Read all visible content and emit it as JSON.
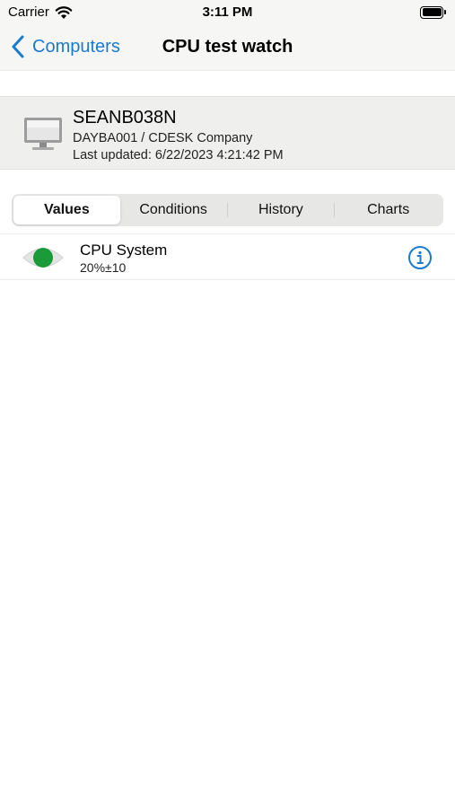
{
  "status_bar": {
    "carrier": "Carrier",
    "time": "3:11 PM"
  },
  "nav": {
    "back_label": "Computers",
    "title": "CPU test watch"
  },
  "computer": {
    "name": "SEANB038N",
    "subtitle": "DAYBA001 / CDESK Company",
    "last_updated": "Last updated: 6/22/2023 4:21:42 PM"
  },
  "tabs": [
    {
      "label": "Values",
      "selected": true
    },
    {
      "label": "Conditions",
      "selected": false
    },
    {
      "label": "History",
      "selected": false
    },
    {
      "label": "Charts",
      "selected": false
    }
  ],
  "values": [
    {
      "title": "CPU System",
      "value": "20%±10",
      "status_color": "#1a9a38"
    }
  ],
  "colors": {
    "accent": "#1a7ad0",
    "status_ok": "#1a9a38"
  }
}
